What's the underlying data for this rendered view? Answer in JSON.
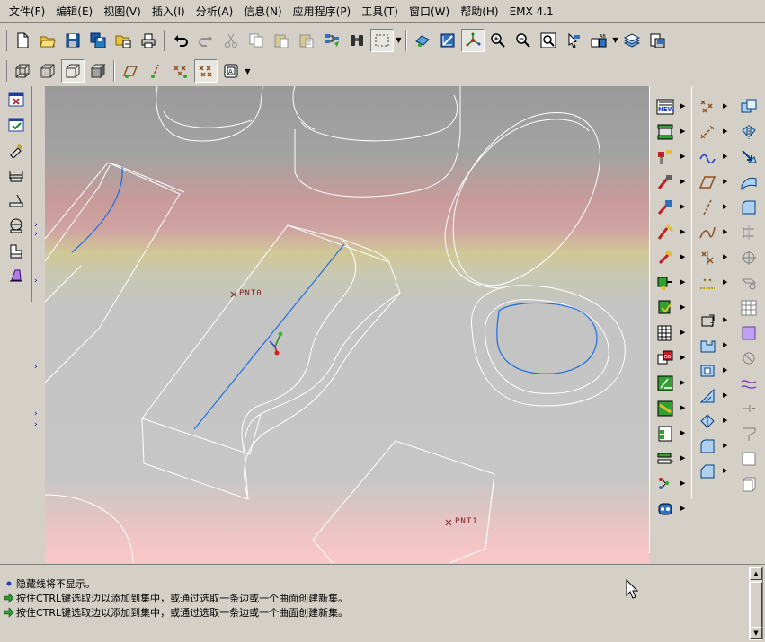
{
  "menu": [
    "文件(F)",
    "编辑(E)",
    "视图(V)",
    "插入(I)",
    "分析(A)",
    "信息(N)",
    "应用程序(P)",
    "工具(T)",
    "窗口(W)",
    "帮助(H)",
    "EMX 4.1"
  ],
  "icons": {
    "toolbar1": [
      "new-file-icon",
      "open-folder-icon",
      "save-icon",
      "save-copy-icon",
      "rename-icon",
      "print-icon",
      "undo-icon",
      "redo-icon",
      "cut-icon",
      "copy-icon",
      "paste-icon",
      "paste-special-icon",
      "regenerate-icon",
      "find-icon",
      "select-box-icon",
      "view-manager-icon",
      "orient-icon",
      "spin-center-icon",
      "zoom-in-icon",
      "zoom-out-icon",
      "refit-icon",
      "repaint-icon",
      "named-view-icon",
      "layers-icon",
      "model-tree-icon"
    ],
    "toolbar2": [
      "wireframe-icon",
      "hidden-line-icon",
      "no-hidden-icon",
      "shading-icon",
      "datum-planes-icon",
      "datum-axes-icon",
      "datum-points-icon",
      "point-display-icon",
      "annotation-icon"
    ],
    "left": [
      "close-window-icon",
      "save-view-icon",
      "drag-icon",
      "measure-icon",
      "angle-icon",
      "diameter-icon",
      "area-icon",
      "mass-icon"
    ],
    "right1": [
      "new-emx-icon",
      "base-plate-icon",
      "guide-pin-icon",
      "ejector-pin-icon",
      "sprue-icon",
      "screw-icon",
      "component-icon",
      "bushing-icon",
      "cooling-icon",
      "plate-layout-icon",
      "slider-icon",
      "lifter-icon",
      "gate-insert-icon",
      "bom-icon",
      "trajectory-icon",
      "eject-icon",
      "assembly-icon"
    ],
    "right2": [
      "datum-point-tool-icon",
      "curve-through-icon",
      "sketch-curve-icon",
      "datum-plane-tool-icon",
      "datum-axis-tool-icon",
      "spline-icon",
      "point-offset-icon",
      "coordinate-system-icon",
      "hole-icon",
      "extrude-icon",
      "shell-icon",
      "rib-icon",
      "draft-icon",
      "round-icon",
      "chamfer-icon"
    ],
    "right3": [
      "copy-feature-icon",
      "mirror-icon",
      "move-icon",
      "surface-icon",
      "boundary-icon",
      "trim-icon",
      "offset-icon",
      "thicken-icon",
      "pattern-icon",
      "merge-icon",
      "solidify-icon",
      "intersect-icon",
      "extend-icon",
      "project-icon",
      "wrap-icon",
      "sweep-icon"
    ]
  },
  "viewport": {
    "point_labels": [
      "PNT0",
      "PNT1"
    ]
  },
  "messages": [
    {
      "icon": "info-bullet-icon",
      "text": "隐藏线将不显示。"
    },
    {
      "icon": "prompt-arrow-icon",
      "text": "按住CTRL键选取边以添加到集中，或通过选取一条边或一个曲面创建新集。"
    },
    {
      "icon": "prompt-arrow-icon",
      "text": "按住CTRL键选取边以添加到集中，或通过选取一条边或一个曲面创建新集。"
    }
  ],
  "colors": {
    "highlight_edge": "#1e6ee0",
    "point_marker": "#8c1c1c",
    "prompt_arrow": "#2a9a2a",
    "info_bullet": "#1a3ad0"
  }
}
